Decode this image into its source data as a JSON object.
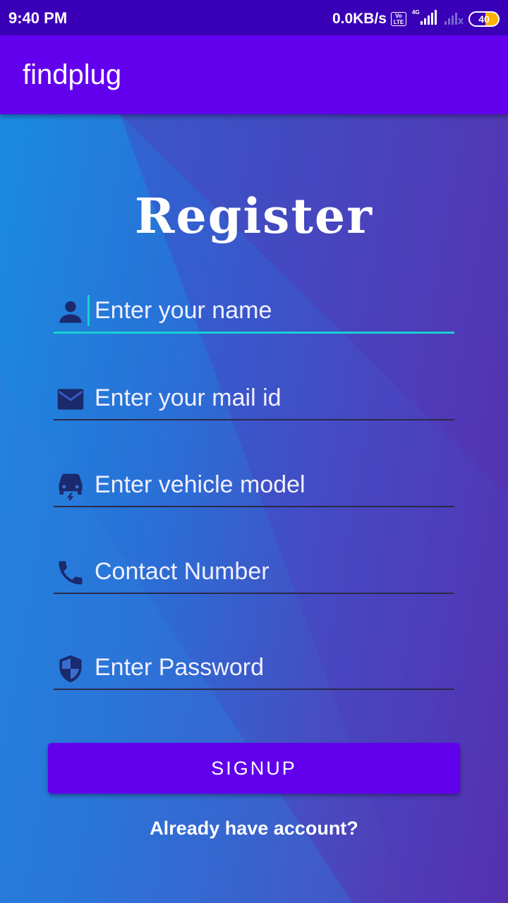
{
  "status_bar": {
    "time": "9:40 PM",
    "net_speed": "0.0KB/s",
    "volte_label": "Vo LTE",
    "network_label": "4G",
    "battery_level": "40"
  },
  "app_bar": {
    "title": "findplug"
  },
  "form": {
    "heading": "Register",
    "fields": [
      {
        "placeholder": "Enter your name",
        "value": "",
        "icon": "person-icon"
      },
      {
        "placeholder": "Enter your mail id",
        "value": "",
        "icon": "mail-icon"
      },
      {
        "placeholder": "Enter vehicle model",
        "value": "",
        "icon": "car-icon"
      },
      {
        "placeholder": "Contact Number",
        "value": "",
        "icon": "phone-icon"
      },
      {
        "placeholder": "Enter Password",
        "value": "",
        "icon": "shield-icon"
      }
    ],
    "signup_label": "SIGNUP",
    "login_link": "Already have account?"
  },
  "colors": {
    "primary": "#6200ee",
    "status_bar": "#3a00b8",
    "accent": "#18d0d0",
    "icon": "#1a2a6c"
  }
}
